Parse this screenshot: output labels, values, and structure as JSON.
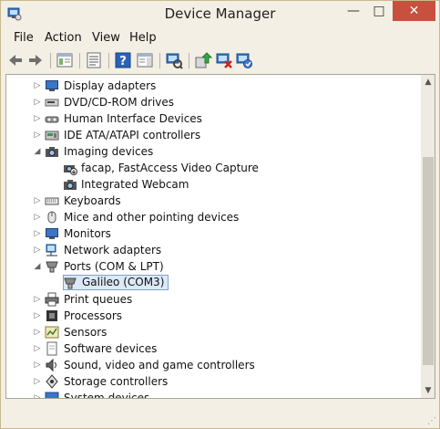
{
  "window": {
    "title": "Device Manager"
  },
  "controls": {
    "minimize": "—",
    "maximize": "□",
    "close": "✕"
  },
  "menu": [
    {
      "label": "File"
    },
    {
      "label": "Action"
    },
    {
      "label": "View"
    },
    {
      "label": "Help"
    }
  ],
  "toolbar": [
    {
      "icon": "back-arrow-icon"
    },
    {
      "icon": "forward-arrow-icon"
    },
    {
      "icon": "show-hide-console-tree-icon"
    },
    {
      "icon": "properties-icon"
    },
    {
      "icon": "help-icon"
    },
    {
      "icon": "show-action-pane-icon"
    },
    {
      "icon": "scan-hardware-changes-icon"
    },
    {
      "icon": "update-driver-icon"
    },
    {
      "icon": "uninstall-device-icon"
    },
    {
      "icon": "enable-device-icon"
    }
  ],
  "tree": [
    {
      "label": "Display adapters",
      "expanded": false,
      "icon": "display-adapter-icon",
      "indent": 0
    },
    {
      "label": "DVD/CD-ROM drives",
      "expanded": false,
      "icon": "dvd-drive-icon",
      "indent": 0
    },
    {
      "label": "Human Interface Devices",
      "expanded": false,
      "icon": "hid-icon",
      "indent": 0
    },
    {
      "label": "IDE ATA/ATAPI controllers",
      "expanded": false,
      "icon": "ide-controller-icon",
      "indent": 0
    },
    {
      "label": "Imaging devices",
      "expanded": true,
      "icon": "imaging-device-icon",
      "indent": 0
    },
    {
      "label": "facap, FastAccess Video Capture",
      "icon": "camera-warning-icon",
      "indent": 1
    },
    {
      "label": "Integrated Webcam",
      "icon": "camera-icon",
      "indent": 1
    },
    {
      "label": "Keyboards",
      "expanded": false,
      "icon": "keyboard-icon",
      "indent": 0
    },
    {
      "label": "Mice and other pointing devices",
      "expanded": false,
      "icon": "mouse-icon",
      "indent": 0
    },
    {
      "label": "Monitors",
      "expanded": false,
      "icon": "monitor-icon",
      "indent": 0
    },
    {
      "label": "Network adapters",
      "expanded": false,
      "icon": "network-adapter-icon",
      "indent": 0
    },
    {
      "label": "Ports (COM & LPT)",
      "expanded": true,
      "icon": "port-icon",
      "indent": 0
    },
    {
      "label": "Galileo (COM3)",
      "icon": "port-icon",
      "indent": 1,
      "selected": true
    },
    {
      "label": "Print queues",
      "expanded": false,
      "icon": "printer-icon",
      "indent": 0
    },
    {
      "label": "Processors",
      "expanded": false,
      "icon": "processor-icon",
      "indent": 0
    },
    {
      "label": "Sensors",
      "expanded": false,
      "icon": "sensor-icon",
      "indent": 0
    },
    {
      "label": "Software devices",
      "expanded": false,
      "icon": "software-device-icon",
      "indent": 0
    },
    {
      "label": "Sound, video and game controllers",
      "expanded": false,
      "icon": "sound-icon",
      "indent": 0
    },
    {
      "label": "Storage controllers",
      "expanded": false,
      "icon": "storage-controller-icon",
      "indent": 0
    },
    {
      "label": "System devices",
      "expanded": false,
      "icon": "system-device-icon",
      "indent": 0
    }
  ],
  "colors": {
    "selection_bg": "#dce9f7",
    "selection_border": "#7da2ce",
    "close_button": "#c7503f",
    "frame": "#f4efe4"
  }
}
